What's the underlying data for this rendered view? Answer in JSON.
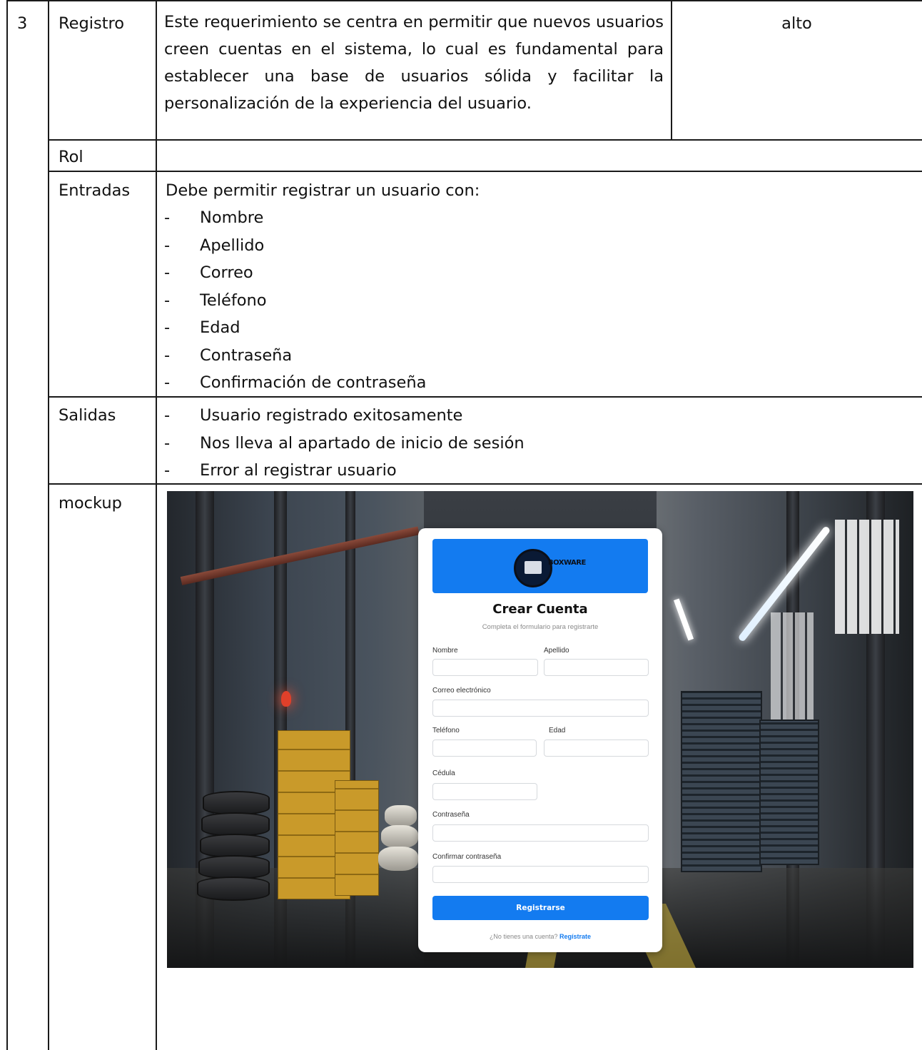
{
  "row": {
    "number": "3",
    "name": "Registro",
    "description": "Este requerimiento se centra en permitir que nuevos usuarios creen cuentas en el sistema, lo cual es fundamental para establecer una base de usuarios sólida y facilitar la personalización de la experiencia del usuario.",
    "priority": "alto"
  },
  "rol": {
    "label": "Rol",
    "value": ""
  },
  "entradas": {
    "label": "Entradas",
    "intro": "Debe permitir registrar un usuario con:",
    "items": [
      "Nombre",
      "Apellido",
      "Correo",
      "Teléfono",
      "Edad",
      "Contraseña",
      "Confirmación de contraseña"
    ]
  },
  "salidas": {
    "label": "Salidas",
    "items": [
      "Usuario registrado exitosamente",
      "Nos lleva al apartado de inicio de sesión",
      "Error al registrar usuario"
    ]
  },
  "mockup": {
    "label": "mockup",
    "form": {
      "logo_text": "BOXWARE",
      "title": "Crear Cuenta",
      "subtitle": "Completa el formulario para registrarte",
      "fields": {
        "nombre": "Nombre",
        "apellido": "Apellido",
        "correo": "Correo electrónico",
        "telefono": "Teléfono",
        "edad": "Edad",
        "cedula": "Cédula",
        "contrasena": "Contraseña",
        "confirmar": "Confirmar contraseña"
      },
      "submit_label": "Registrarse",
      "footer_text": "¿No tienes una cuenta?",
      "footer_link": "Regístrate"
    }
  },
  "colors": {
    "accent": "#137bf0",
    "border": "#1a1a1a"
  }
}
